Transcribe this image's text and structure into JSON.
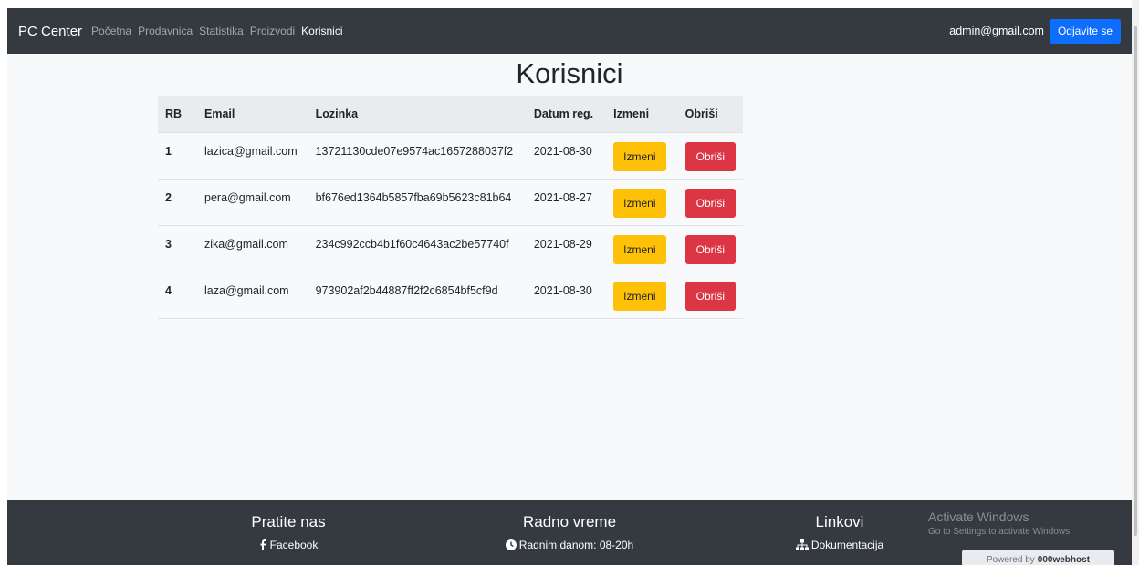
{
  "navbar": {
    "brand": "PC Center",
    "links": [
      "Početna",
      "Prodavnica",
      "Statistika",
      "Proizvodi",
      "Korisnici"
    ],
    "active_link": "Korisnici",
    "user_email": "admin@gmail.com",
    "logout_label": "Odjavite se"
  },
  "page": {
    "title": "Korisnici"
  },
  "table": {
    "headers": [
      "RB",
      "Email",
      "Lozinka",
      "Datum reg.",
      "Izmeni",
      "Obriši"
    ],
    "rows": [
      {
        "rb": "1",
        "email": "lazica@gmail.com",
        "password": "13721130cde07e9574ac1657288037f2",
        "date": "2021-08-30",
        "edit": "Izmeni",
        "delete": "Obriši"
      },
      {
        "rb": "2",
        "email": "pera@gmail.com",
        "password": "bf676ed1364b5857fba69b5623c81b64",
        "date": "2021-08-27",
        "edit": "Izmeni",
        "delete": "Obriši"
      },
      {
        "rb": "3",
        "email": "zika@gmail.com",
        "password": "234c992ccb4b1f60c4643ac2be57740f",
        "date": "2021-08-29",
        "edit": "Izmeni",
        "delete": "Obriši"
      },
      {
        "rb": "4",
        "email": "laza@gmail.com",
        "password": "973902af2b44887ff2f2c6854bf5cf9d",
        "date": "2021-08-30",
        "edit": "Izmeni",
        "delete": "Obriši"
      }
    ]
  },
  "footer": {
    "follow": {
      "title": "Pratite nas",
      "items": [
        {
          "icon": "facebook-icon",
          "label": "Facebook"
        }
      ]
    },
    "hours": {
      "title": "Radno vreme",
      "items": [
        {
          "icon": "clock-icon",
          "label": "Radnim danom: 08-20h"
        }
      ]
    },
    "links": {
      "title": "Linkovi",
      "items": [
        {
          "icon": "sitemap-icon",
          "label": "Dokumentacija"
        }
      ]
    }
  },
  "overlay": {
    "activate_title": "Activate Windows",
    "activate_sub": "Go to Settings to activate Windows.",
    "powered_by": "Powered by",
    "host": "000webhost"
  },
  "colors": {
    "navbar_bg": "#343a40",
    "primary": "#0d6efd",
    "warning": "#ffc107",
    "danger": "#dc3545",
    "page_bg": "#f8f9fa"
  }
}
